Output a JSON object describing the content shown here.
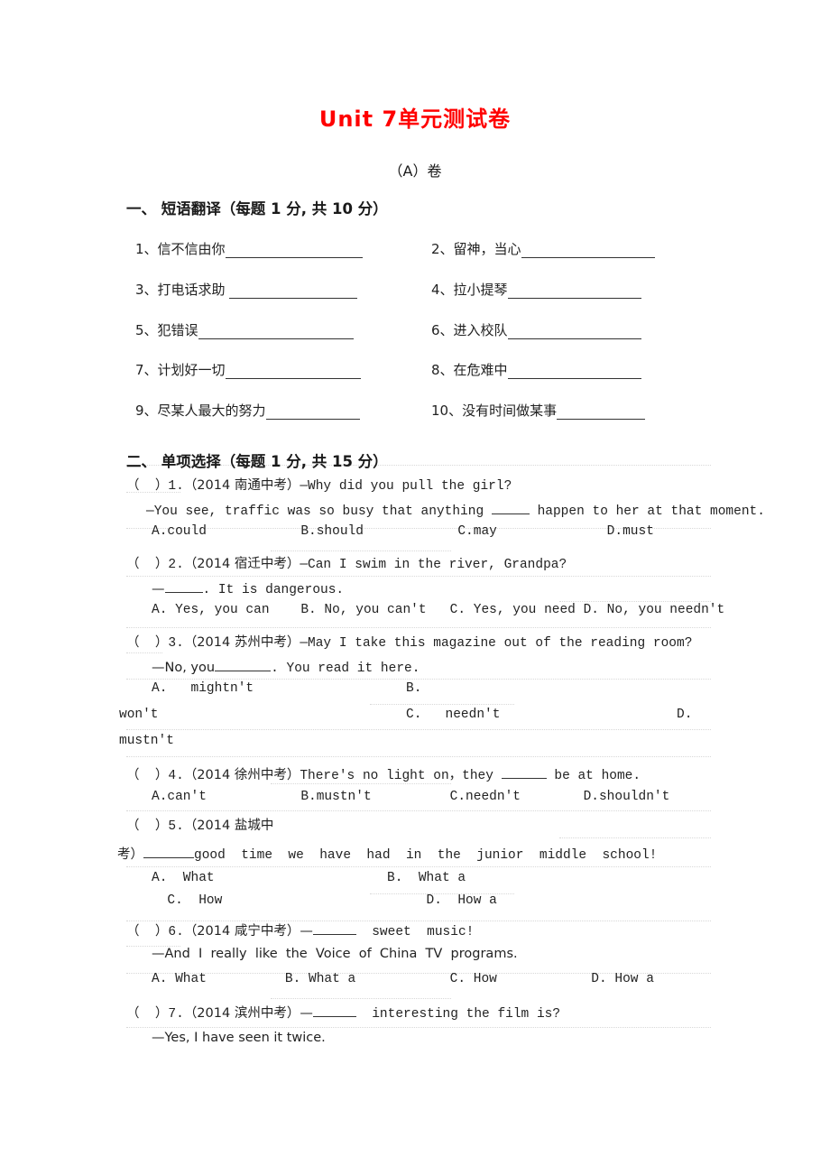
{
  "document": {
    "title": "Unit 7单元测试卷",
    "subtitle": "（A）卷"
  },
  "section_one": {
    "heading": "一、 短语翻译（每题 1 分, 共 10 分）",
    "items": [
      {
        "num": "1、",
        "text": "信不信由你",
        "blank_width": 152
      },
      {
        "num": "2、",
        "text": "留神，当心",
        "blank_width": 148
      },
      {
        "num": "3、",
        "text": "打电话求助 ",
        "blank_width": 142
      },
      {
        "num": "4、",
        "text": "拉小提琴",
        "blank_width": 148
      },
      {
        "num": "5、",
        "text": "犯错误",
        "blank_width": 172
      },
      {
        "num": "6、",
        "text": "进入校队",
        "blank_width": 148
      },
      {
        "num": "7、",
        "text": "计划好一切",
        "blank_width": 150
      },
      {
        "num": "8、",
        "text": "在危难中",
        "blank_width": 148
      },
      {
        "num": "9、",
        "text": "尽某人最大的努力",
        "blank_width": 104
      },
      {
        "num": "10、",
        "text": "没有时间做某事",
        "blank_width": 98
      }
    ]
  },
  "section_two": {
    "heading": "二、 单项选择（每题 1 分, 共 15 分）",
    "questions": [
      {
        "marker": "（  ）1.",
        "source": "（2014 南通中考）",
        "stem": "—Why did you pull the girl?",
        "stem2_a": "—You see, traffic was so busy that anything ",
        "stem2_b": " happen to her at that moment.",
        "options_line": "A.could            B.should            C.may              D.must"
      },
      {
        "marker": "（  ）2.",
        "source": "（2014 宿迁中考）",
        "stem": "—Can I swim in the river, Grandpa?",
        "stem2_a": "—",
        "stem2_b": ". It is dangerous.",
        "options_line": "A. Yes, you can    B. No, you can't   C. Yes, you need D. No, you needn't"
      },
      {
        "marker": "（  ）3.",
        "source": "（2014 苏州中考）",
        "stem": "—May I take this magazine out of the reading room?",
        "stem2_a": "—No, you",
        "stem2_b": ". You read it here.",
        "opt_a": "A.   mightn't",
        "opt_b": "B.",
        "opt_b_cont": "won't",
        "opt_c": "C.   needn't",
        "opt_d": "D.",
        "opt_d_cont": "mustn't"
      },
      {
        "marker": "（  ）4.",
        "source": "（2014 徐州中考）",
        "stem_a": "There's no light on，they ",
        "stem_b": " be at home.",
        "options_line": "A.can't            B.mustn't          C.needn't        D.shouldn't"
      },
      {
        "marker": "（  ）5.",
        "source_line1": "（2014 盐城中",
        "source_line2": "考）",
        "stem2_b": "good  time  we  have  had  in  the  junior  middle  school!",
        "opt_ab": "A.  What                      B.  What a",
        "opt_cd": "  C.  How                          D.  How a"
      },
      {
        "marker": "（  ）6.",
        "source": "（2014 咸宁中考）",
        "stem_a": "—",
        "stem_b": "  sweet  music!",
        "stem2": "—And  I  really  like  the  Voice  of  China  TV  programs.",
        "options_line": "A. What          B. What a            C. How            D. How a"
      },
      {
        "marker": "（  ）7.",
        "source": "（2014 滨州中考）",
        "stem_a": "—",
        "stem_b": "  interesting the film is?",
        "stem2": "—Yes, I have seen it twice."
      }
    ]
  },
  "colors": {
    "title_red": "#ff0000",
    "text": "#222222",
    "gridline": "#d8d8d8"
  }
}
